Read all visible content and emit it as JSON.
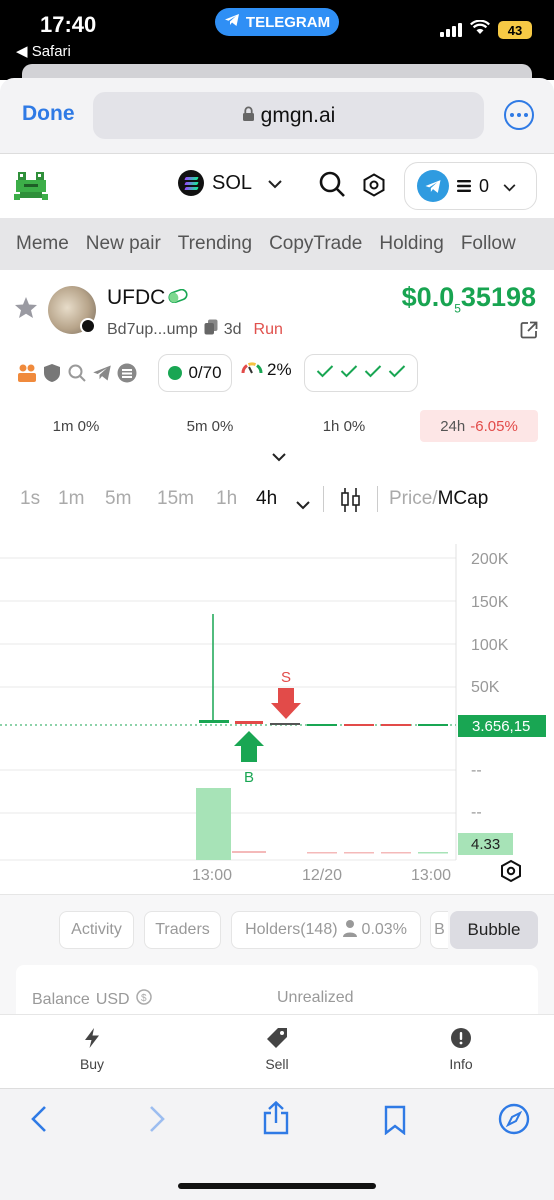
{
  "status_bar": {
    "time": "17:40",
    "back_app": "◀ Safari",
    "pill": "TELEGRAM",
    "battery": "43"
  },
  "safari": {
    "done": "Done",
    "url": "gmgn.ai"
  },
  "header": {
    "chain": "SOL",
    "wallet_balance": "0"
  },
  "nav": [
    "Meme",
    "New pair",
    "Trending",
    "CopyTrade",
    "Holding",
    "Follow"
  ],
  "token": {
    "name": "UFDC",
    "address": "Bd7up...ump",
    "age": "3d",
    "status": "Run",
    "price_main": "$0.0",
    "price_zeros": "5",
    "price_rest": "35198",
    "holders_ratio": "0/70",
    "gauge": "2%"
  },
  "periods": [
    {
      "label": "1m",
      "value": "0%"
    },
    {
      "label": "5m",
      "value": "0%"
    },
    {
      "label": "1h",
      "value": "0%"
    },
    {
      "label": "24h",
      "value": "-6.05%"
    }
  ],
  "timeframes": [
    "1s",
    "1m",
    "5m",
    "15m",
    "1h",
    "4h"
  ],
  "price_toggle": {
    "a": "Price",
    "sep": "/",
    "b": "MCap"
  },
  "chart": {
    "y_labels": [
      "200K",
      "150K",
      "100K",
      "50K",
      "--",
      "--"
    ],
    "x_labels": [
      "13:00",
      "12/20",
      "13:00"
    ],
    "current_price_tag": "3.656,15",
    "volume_tag": "4.33",
    "buy_marker": "B",
    "sell_marker": "S",
    "colors": {
      "up": "#19a653",
      "down": "#e24b49",
      "volume_up": "#a7e3b7"
    }
  },
  "tabs": [
    "Activity",
    "Traders",
    "Holders(148)",
    "0.03%",
    "B",
    "Bubble"
  ],
  "balance": {
    "label": "Balance",
    "currency": "USD",
    "unrealized": "Unrealized"
  },
  "actions": [
    {
      "label": "Buy",
      "icon": "lightning-icon"
    },
    {
      "label": "Sell",
      "icon": "tag-icon"
    },
    {
      "label": "Info",
      "icon": "info-icon"
    }
  ]
}
